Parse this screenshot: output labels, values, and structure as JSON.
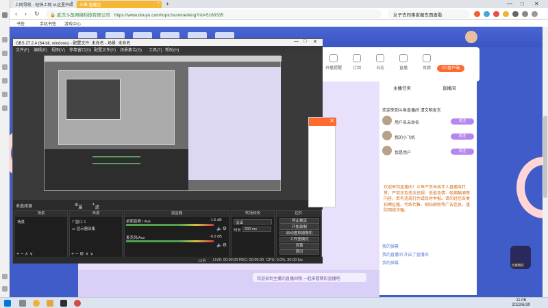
{
  "browser": {
    "tabs": [
      {
        "label": "上网导航 - 轻快上网 从这里开始",
        "icon": "browser-home-icon"
      },
      {
        "label": "斗鱼 直播主",
        "icon": "douyu-tab-icon"
      }
    ],
    "url_site_name": "武汉斗鱼网络科技有限公司",
    "url": "https://www.douyu.com/topic/summerking?rid=5160335",
    "search_text": "女子去同事家搬东西查看",
    "bookmarks": [
      "书签",
      "手机书签",
      "游戏中心"
    ]
  },
  "douyu": {
    "banner_items": [
      "开播提醒",
      "订阅",
      "日志",
      "直播",
      "竞猜",
      "更多"
    ],
    "pc_button": "PC客户端",
    "chat": {
      "tabs": [
        "主播任务",
        "直播间"
      ],
      "notice": "欢迎来到斗鱼直播间 请文明发言",
      "follow_label": "关注",
      "users": [
        "用户名未命名",
        "我的小飞机",
        "我是用户"
      ],
      "system_text": "欢迎来到直播间！斗鱼严禁未成年人直播或打赏，严禁涉及违法违规、低俗色情、吸烟酗酒等内容，若有违规行为请及时举报。请勿轻信各类招聘征婚、代练代售、刷钻刷粉等广告信息，谨防网络诈骗。",
      "messages": [
        "我的弹幕",
        "我的直播间 开启了直播间",
        "我的弹幕"
      ],
      "tooltip": "欢迎来到主播的直播间哦 一起来看精彩直播吧"
    },
    "mascot_text": "比赛精彩"
  },
  "obs": {
    "title": "OBS 27.2.4 (64-bit, windows) - 配置文件: 未命名 - 场景: 未命名",
    "menu": [
      "文件(F)",
      "编辑(E)",
      "视图(V)",
      "停靠窗口(D)",
      "配置文件(P)",
      "场景集合(S)",
      "工具(T)",
      "帮助(H)"
    ],
    "scene_bar": {
      "label": "未选择源",
      "props": "属性",
      "filters": "滤镜"
    },
    "docks": {
      "scenes": {
        "title": "场景",
        "item": "场景"
      },
      "sources": {
        "title": "来源",
        "items": [
          "窗口 1",
          "显示器采集"
        ]
      },
      "mixer": {
        "title": "混音器",
        "ch1": "桌面音频 / Aux",
        "ch1_db": "-1.6 dB",
        "ch2": "麦克风/Aux",
        "ch2_db": "-0.0 dB"
      },
      "transitions": {
        "title": "转场特效",
        "type": "淡出",
        "duration_label": "时长",
        "duration": "300 ms"
      },
      "controls": {
        "title": "控件",
        "buttons": [
          "停止推流",
          "开始录制",
          "启动虚拟摄像机",
          "工作室模式",
          "设置",
          "退出"
        ]
      }
    },
    "status": {
      "live": "LIVE: 00:00:00",
      "rec": "REC: 00:00:00",
      "cpu": "CPU: 0.0%, 30.00 fps",
      "frames": "12节"
    }
  },
  "taskbar": {
    "time": "11:06",
    "date": "2022/6/30"
  }
}
